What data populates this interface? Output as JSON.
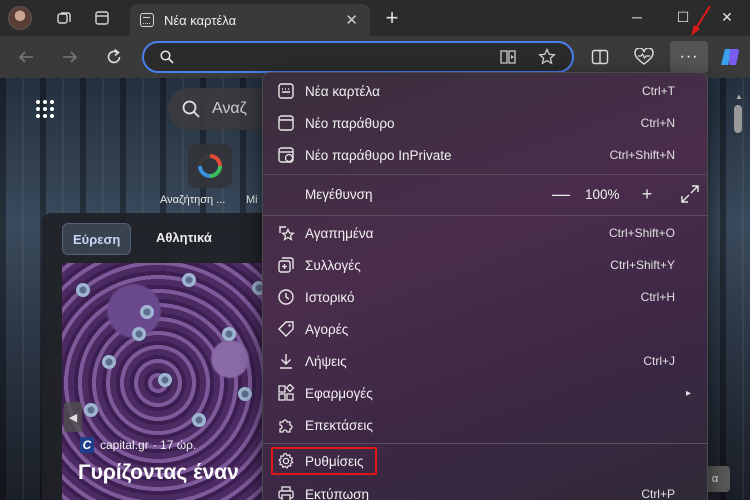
{
  "window": {
    "tab_title": "Νέα καρτέλα",
    "tab_close": "✕",
    "new_tab": "+",
    "minimize": "─",
    "maximize": "☐",
    "close": "✕"
  },
  "toolbar": {
    "address_placeholder": "",
    "more_label": "···"
  },
  "page": {
    "search_text": "Αναζ",
    "quicklink_label": "Αναζήτηση ...",
    "quicklink2_label": "Mi",
    "feed_tabs": [
      "Εύρεση",
      "Αθλητικά"
    ],
    "article_source": "capital.gr",
    "article_time": "· 17 ώρ.",
    "article_source_logo": "C",
    "article_headline": "Γυρίζοντας έναν",
    "article_prev": "◀",
    "corner_button": "α"
  },
  "menu": {
    "items": [
      {
        "label": "Νέα καρτέλα",
        "shortcut": "Ctrl+T",
        "icon": "new-tab-icon"
      },
      {
        "label": "Νέο παράθυρο",
        "shortcut": "Ctrl+N",
        "icon": "new-window-icon"
      },
      {
        "label": "Νέο παράθυρο InPrivate",
        "shortcut": "Ctrl+Shift+N",
        "icon": "inprivate-icon"
      },
      {
        "label": "Μεγέθυνση",
        "shortcut": "",
        "icon": ""
      },
      {
        "label": "Αγαπημένα",
        "shortcut": "Ctrl+Shift+O",
        "icon": "favorites-icon"
      },
      {
        "label": "Συλλογές",
        "shortcut": "Ctrl+Shift+Y",
        "icon": "collections-icon"
      },
      {
        "label": "Ιστορικό",
        "shortcut": "Ctrl+H",
        "icon": "history-icon"
      },
      {
        "label": "Αγορές",
        "shortcut": "",
        "icon": "shopping-tag-icon"
      },
      {
        "label": "Λήψεις",
        "shortcut": "Ctrl+J",
        "icon": "download-icon"
      },
      {
        "label": "Εφαρμογές",
        "shortcut": "",
        "icon": "apps-icon"
      },
      {
        "label": "Επεκτάσεις",
        "shortcut": "",
        "icon": "extensions-icon"
      },
      {
        "label": "Ρυθμίσεις",
        "shortcut": "",
        "icon": "settings-gear-icon"
      },
      {
        "label": "Εκτύπωση",
        "shortcut": "Ctrl+P",
        "icon": "print-icon"
      }
    ],
    "zoom_minus": "—",
    "zoom_value": "100%",
    "zoom_plus": "+",
    "submenu_arrow": "▸"
  },
  "colors": {
    "address_focus": "#4a7ff0",
    "highlight": "#e01818",
    "annotation_arrow": "#e01818"
  }
}
